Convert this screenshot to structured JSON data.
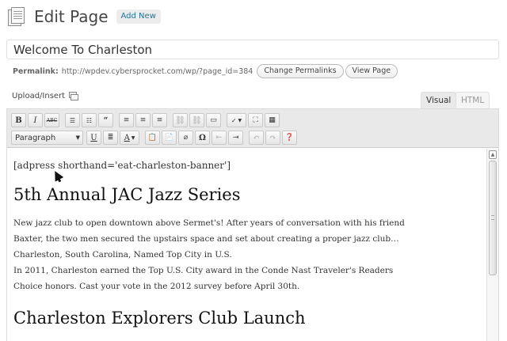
{
  "header": {
    "title": "Edit Page",
    "add_new": "Add New"
  },
  "title_field": {
    "value": "Welcome To Charleston"
  },
  "permalink": {
    "label": "Permalink:",
    "url": "http://wpdev.cybersprocket.com/wp/?page_id=384",
    "change_button": "Change Permalinks",
    "view_button": "View Page"
  },
  "media": {
    "upload_insert": "Upload/Insert"
  },
  "tabs": {
    "visual": "Visual",
    "html": "HTML"
  },
  "toolbar": {
    "row1": [
      "bold",
      "italic",
      "strikethrough",
      "bullet-list",
      "numbered-list",
      "blockquote",
      "align-left",
      "align-center",
      "align-right",
      "link",
      "unlink",
      "more",
      "spellcheck",
      "fullscreen",
      "kitchen-sink"
    ],
    "format_select": "Paragraph",
    "row2": [
      "underline",
      "justify",
      "text-color",
      "paste-text",
      "paste-word",
      "remove-format",
      "special-char",
      "outdent",
      "indent",
      "undo",
      "redo",
      "help"
    ]
  },
  "content": {
    "shortcode": "[adpress shorthand='eat-charleston-banner']",
    "heading1": "5th Annual JAC Jazz Series",
    "para_lines": [
      "New jazz club to open downtown above Sermet's! After years of conversation with his friend",
      "Baxter, the two men secured the upstairs space and set about creating a proper jazz club…",
      "Charleston, South Carolina, Named Top City in U.S.",
      "In 2011, Charleston earned the Top U.S. City award in the Conde Nast Traveler's Readers",
      "Choice honors. Cast your vote in the 2012 survey before April 30th."
    ],
    "heading2": "Charleston Explorers Club Launch"
  },
  "colors": {
    "link": "#21759b",
    "toolbar_bg": "#e9e9e9",
    "border": "#dfdfdf"
  }
}
